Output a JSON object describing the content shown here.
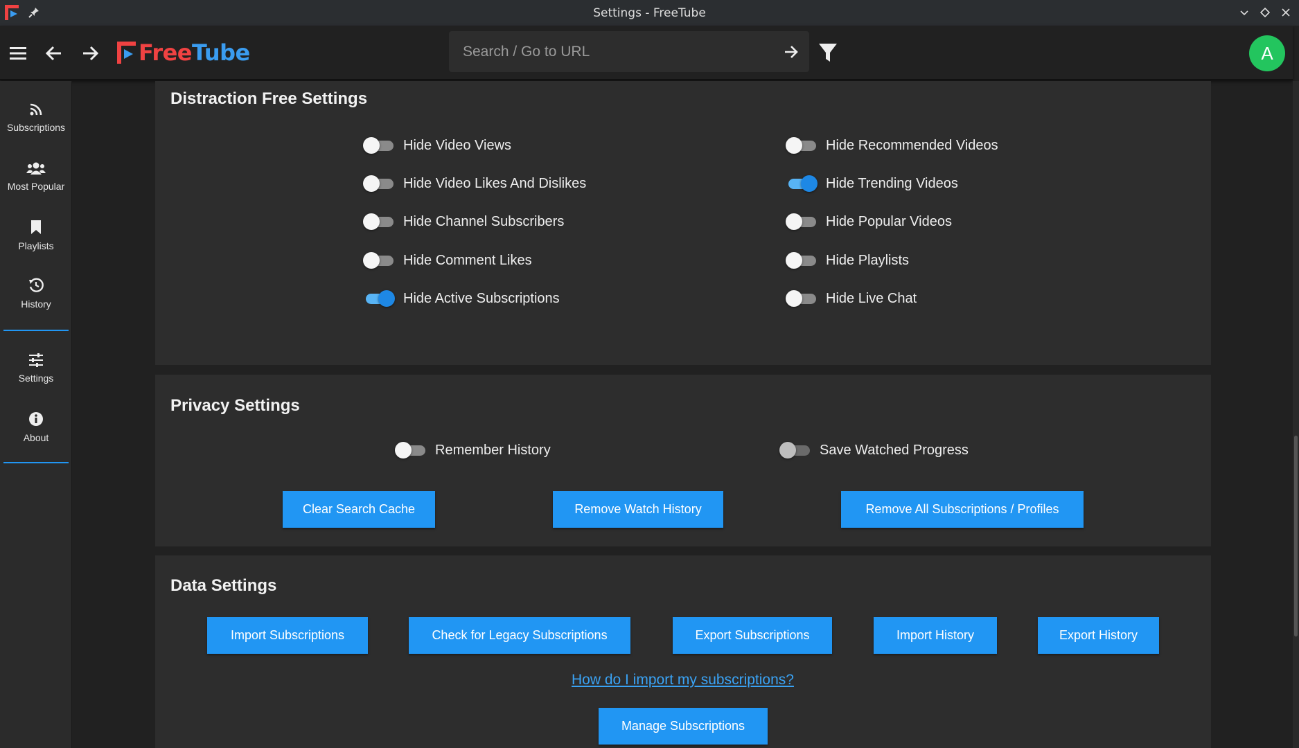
{
  "window": {
    "title": "Settings - FreeTube"
  },
  "header": {
    "logo": {
      "part1": "Free",
      "part2": "Tube"
    },
    "search": {
      "placeholder": "Search / Go to URL"
    },
    "avatar_letter": "A"
  },
  "sidebar": {
    "items": [
      {
        "label": "Subscriptions",
        "icon": "rss-icon"
      },
      {
        "label": "Most Popular",
        "icon": "users-icon"
      },
      {
        "label": "Playlists",
        "icon": "bookmark-icon"
      },
      {
        "label": "History",
        "icon": "history-icon"
      },
      {
        "label": "Settings",
        "icon": "sliders-icon"
      },
      {
        "label": "About",
        "icon": "info-icon"
      }
    ]
  },
  "distraction": {
    "title": "Distraction Free Settings",
    "left": [
      {
        "label": "Hide Video Views",
        "on": false
      },
      {
        "label": "Hide Video Likes And Dislikes",
        "on": false
      },
      {
        "label": "Hide Channel Subscribers",
        "on": false
      },
      {
        "label": "Hide Comment Likes",
        "on": false
      },
      {
        "label": "Hide Active Subscriptions",
        "on": true
      }
    ],
    "right": [
      {
        "label": "Hide Recommended Videos",
        "on": false
      },
      {
        "label": "Hide Trending Videos",
        "on": true
      },
      {
        "label": "Hide Popular Videos",
        "on": false
      },
      {
        "label": "Hide Playlists",
        "on": false
      },
      {
        "label": "Hide Live Chat",
        "on": false
      }
    ]
  },
  "privacy": {
    "title": "Privacy Settings",
    "toggles": [
      {
        "label": "Remember History",
        "on": false
      },
      {
        "label": "Save Watched Progress",
        "on": false
      }
    ],
    "buttons": [
      "Clear Search Cache",
      "Remove Watch History",
      "Remove All Subscriptions / Profiles"
    ]
  },
  "data_settings": {
    "title": "Data Settings",
    "buttons": [
      "Import Subscriptions",
      "Check for Legacy Subscriptions",
      "Export Subscriptions",
      "Import History",
      "Export History"
    ],
    "help_link": "How do I import my subscriptions?",
    "manage_button": "Manage Subscriptions"
  },
  "colors": {
    "accent": "#2196f3",
    "avatar": "#23c55e",
    "logo_red": "#f04242",
    "logo_blue": "#3a9cf0"
  }
}
